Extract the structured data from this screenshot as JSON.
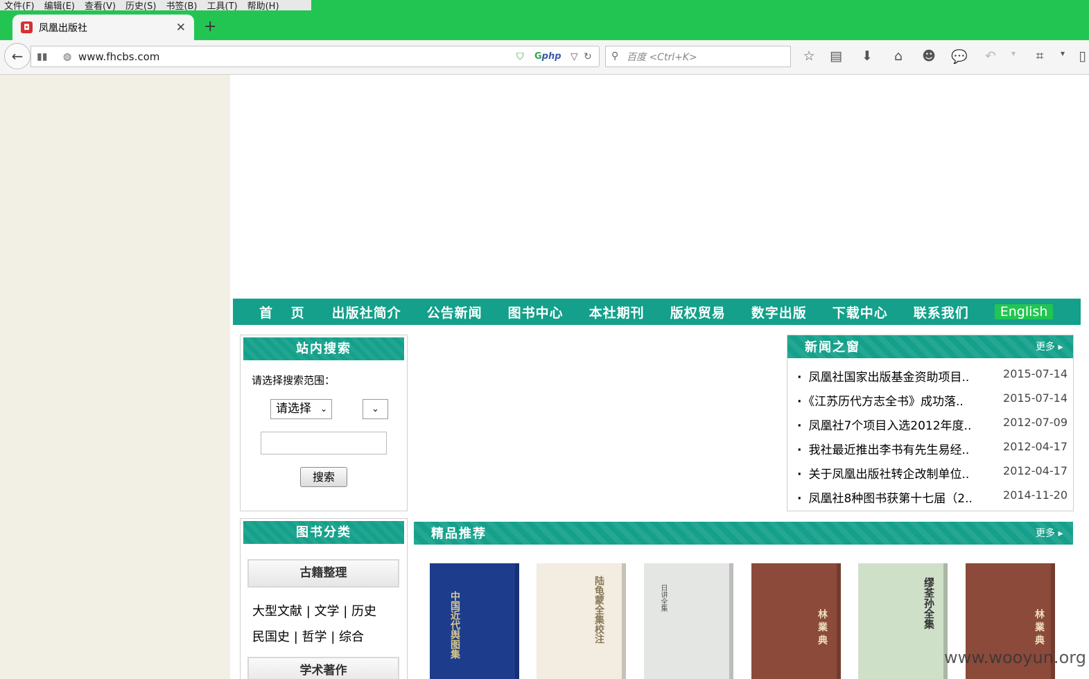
{
  "browser": {
    "menu": [
      "文件(F)",
      "编辑(E)",
      "查看(V)",
      "历史(S)",
      "书签(B)",
      "工具(T)",
      "帮助(H)"
    ],
    "tab_title": "凤凰出版社",
    "url": "www.fhcbs.com",
    "search_placeholder": "百度 <Ctrl+K>",
    "accent": "#23c552"
  },
  "site": {
    "nav": [
      "首 页",
      "出版社简介",
      "公告新闻",
      "图书中心",
      "本社期刊",
      "版权贸易",
      "数字出版",
      "下载中心",
      "联系我们",
      "English"
    ],
    "theme_color": "#14a08a",
    "search": {
      "title": "站内搜索",
      "label": "请选择搜索范围：",
      "select_value": "请选择",
      "button": "搜索"
    },
    "news": {
      "title": "新闻之窗",
      "more": "更多",
      "items": [
        {
          "title": "凤凰社国家出版基金资助项目..",
          "date": "2015-07-14"
        },
        {
          "title": "《江苏历代方志全书》成功落..",
          "date": "2015-07-14"
        },
        {
          "title": "凤凰社7个项目入选2012年度..",
          "date": "2012-07-09"
        },
        {
          "title": "我社最近推出李书有先生易经..",
          "date": "2012-04-17"
        },
        {
          "title": "关于凤凰出版社转企改制单位..",
          "date": "2012-04-17"
        },
        {
          "title": "凤凰社8种图书获第十七届（2..",
          "date": "2014-11-20"
        }
      ]
    },
    "categories": {
      "title": "图书分类",
      "group1": "古籍整理",
      "line1": "大型文献 | 文学 | 历史",
      "line2": "民国史 | 哲学 | 综合",
      "group2": "学术著作"
    },
    "recommend": {
      "title": "精品推荐",
      "more": "更多",
      "books": [
        {
          "spine": "中国近代舆图集",
          "color": "#1d3c8c",
          "text": "#d8c88a"
        },
        {
          "spine": "陆龟蒙全集校注",
          "color": "#f3ece0",
          "text": "#8a7a5a"
        },
        {
          "spine": "日讲全集",
          "color": "#e4e6e4",
          "text": "#555"
        },
        {
          "spine": "林 業 典",
          "color": "#8b4a3a",
          "text": "#f0e0c0"
        },
        {
          "spine": "缪荃孙全集",
          "color": "#cfe0c8",
          "text": "#333"
        },
        {
          "spine": "林 業 典",
          "color": "#8b4a3a",
          "text": "#f0e0c0"
        }
      ]
    }
  },
  "watermark": "www.wooyun.org"
}
